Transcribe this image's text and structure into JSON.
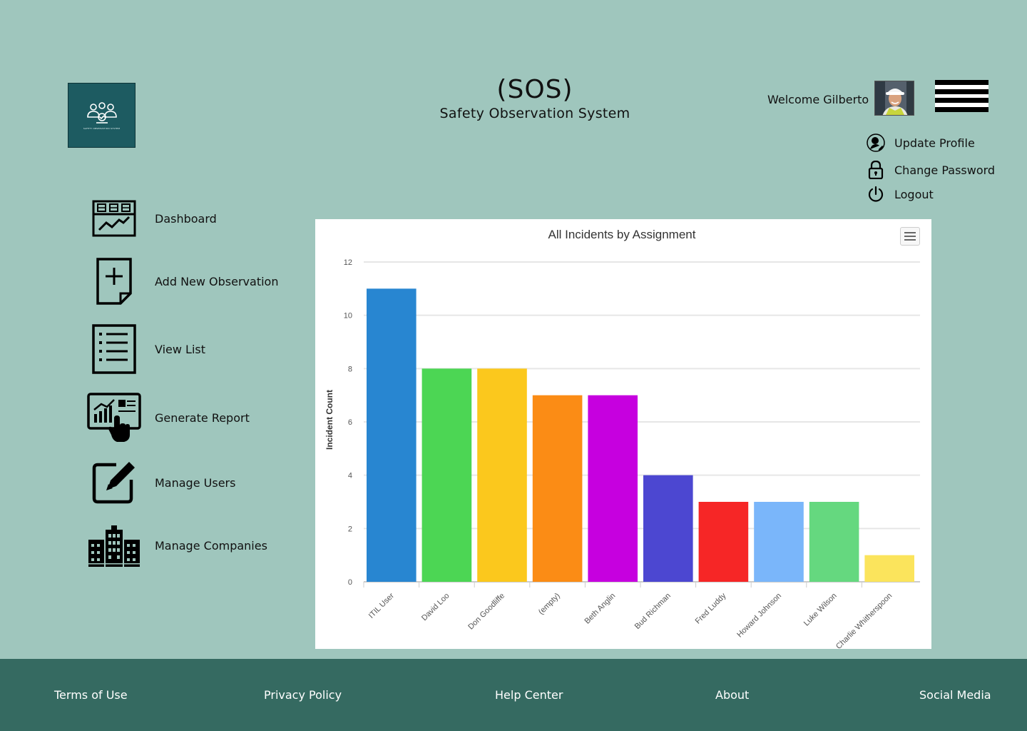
{
  "app": {
    "abbr": "(SOS)",
    "name": "Safety Observation System",
    "logo_caption": "SAFETY OBSERVATION SYSTEM"
  },
  "header": {
    "welcome": "Welcome Gilberto"
  },
  "user_menu": [
    {
      "label": "Update Profile",
      "icon": "user-edit-icon"
    },
    {
      "label": "Change Password",
      "icon": "lock-icon"
    },
    {
      "label": "Logout",
      "icon": "power-icon"
    }
  ],
  "nav": [
    {
      "label": "Dashboard",
      "icon": "dashboard-icon"
    },
    {
      "label": "Add New Observation",
      "icon": "add-document-icon"
    },
    {
      "label": "View List",
      "icon": "list-icon"
    },
    {
      "label": "Generate Report",
      "icon": "report-icon"
    },
    {
      "label": "Manage Users",
      "icon": "edit-icon"
    },
    {
      "label": "Manage Companies",
      "icon": "buildings-icon"
    }
  ],
  "chart_data": {
    "type": "bar",
    "title": "All Incidents by Assignment",
    "xlabel": "",
    "ylabel": "Incident Count",
    "ylim": [
      0,
      12
    ],
    "yticks": [
      0,
      2,
      4,
      6,
      8,
      10,
      12
    ],
    "grid": true,
    "categories": [
      "ITIL User",
      "David Loo",
      "Don Goodliffe",
      "(empty)",
      "Beth Anglin",
      "Bud Richman",
      "Fred Luddy",
      "Howard Johnson",
      "Luke Wilson",
      "Charlie Whitherspoon"
    ],
    "values": [
      11,
      8,
      8,
      7,
      7,
      4,
      3,
      3,
      3,
      1
    ],
    "colors": [
      "#2886d1",
      "#4cd654",
      "#fbc81d",
      "#fb8c15",
      "#c600df",
      "#4c47d1",
      "#f62626",
      "#7ab6fa",
      "#65d87f",
      "#fbe45c"
    ]
  },
  "footer": {
    "links": [
      "Terms of Use",
      "Privacy Policy",
      "Help Center",
      "About",
      "Social Media"
    ]
  },
  "colors": {
    "background": "#9fc6bd",
    "footer": "#356a61",
    "logo_bg": "#1d5b61"
  }
}
